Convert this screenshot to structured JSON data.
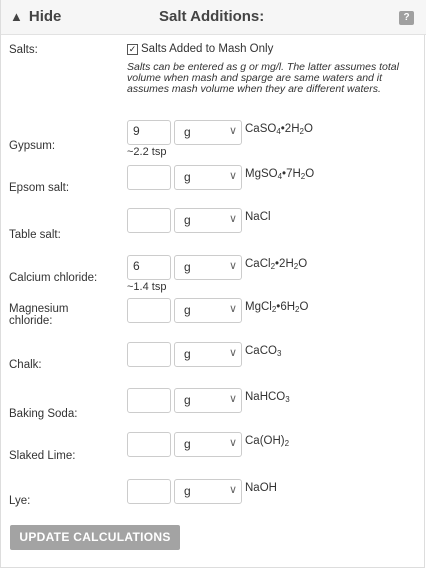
{
  "header": {
    "hide_label": "Hide",
    "hide_arrow": "▲",
    "title": "Salt Additions:",
    "help_label": "?"
  },
  "salts": {
    "label": "Salts:",
    "checkbox_checked": true,
    "checkbox_mark": "✓",
    "checkbox_label": "Salts Added to Mash Only",
    "note": "Salts can be entered as g or mg/l. The latter assumes total volume when mash and sparge are same waters and it assumes mash volume when they are different waters."
  },
  "rows": [
    {
      "name": "Gypsum:",
      "amount": "9",
      "unit": "g",
      "formula": [
        "CaSO",
        "4",
        "•2H",
        "2",
        "O"
      ],
      "tsp": "~2.2 tsp"
    },
    {
      "name": "Epsom salt:",
      "amount": "",
      "unit": "g",
      "formula": [
        "MgSO",
        "4",
        "•7H",
        "2",
        "O"
      ],
      "tsp": ""
    },
    {
      "name": "Table salt:",
      "amount": "",
      "unit": "g",
      "formula": [
        "NaCl"
      ],
      "tsp": ""
    },
    {
      "name": "Calcium chloride:",
      "amount": "6",
      "unit": "g",
      "formula": [
        "CaCl",
        "2",
        "•2H",
        "2",
        "O"
      ],
      "tsp": "~1.4 tsp"
    },
    {
      "name": "Magnesium chloride:",
      "amount": "",
      "unit": "g",
      "formula": [
        "MgCl",
        "2",
        "•6H",
        "2",
        "O"
      ],
      "tsp": ""
    },
    {
      "name": "Chalk:",
      "amount": "",
      "unit": "g",
      "formula": [
        "CaCO",
        "3"
      ],
      "tsp": ""
    },
    {
      "name": "Baking Soda:",
      "amount": "",
      "unit": "g",
      "formula": [
        "NaHCO",
        "3"
      ],
      "tsp": ""
    },
    {
      "name": "Slaked Lime:",
      "amount": "",
      "unit": "g",
      "formula": [
        "Ca(OH)",
        "2"
      ],
      "tsp": ""
    },
    {
      "name": "Lye:",
      "amount": "",
      "unit": "g",
      "formula": [
        "NaOH"
      ],
      "tsp": ""
    }
  ],
  "unit_arrow": "∨",
  "update_button": "UPDATE CALCULATIONS"
}
